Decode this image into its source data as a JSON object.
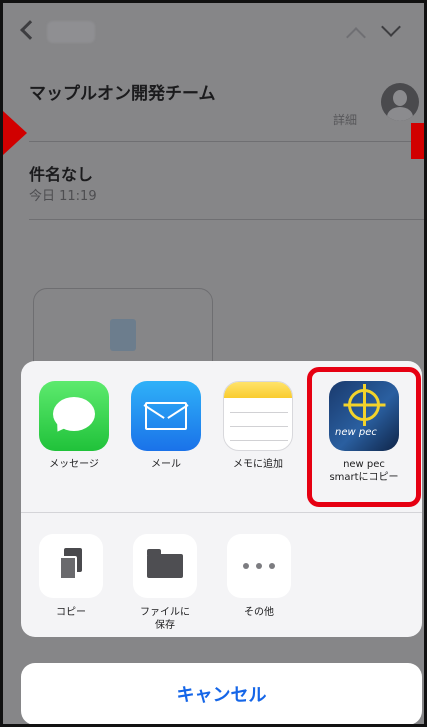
{
  "mail": {
    "sender": "マップルオン開発チーム",
    "detail_label": "詳細",
    "subject": "件名なし",
    "date": "今日 11:19"
  },
  "share_sheet": {
    "apps": [
      {
        "label": "メッセージ",
        "icon": "messages-icon"
      },
      {
        "label": "メール",
        "icon": "mail-icon"
      },
      {
        "label": "メモに追加",
        "icon": "notes-icon"
      },
      {
        "label": "new pec\nsmartにコピー",
        "label_line1": "new pec",
        "label_line2": "smartにコピー",
        "icon": "new-pec-icon",
        "icon_text": "new pec"
      }
    ],
    "actions": [
      {
        "label": "コピー",
        "icon": "copy-icon"
      },
      {
        "label": "ファイルに\n保存",
        "label_line1": "ファイルに",
        "label_line2": "保存",
        "icon": "folder-icon"
      },
      {
        "label": "その他",
        "icon": "more-icon"
      }
    ],
    "cancel_label": "キャンセル"
  },
  "colors": {
    "highlight": "#e60012",
    "cancel_text": "#1566e8",
    "marker": "#d10000"
  }
}
